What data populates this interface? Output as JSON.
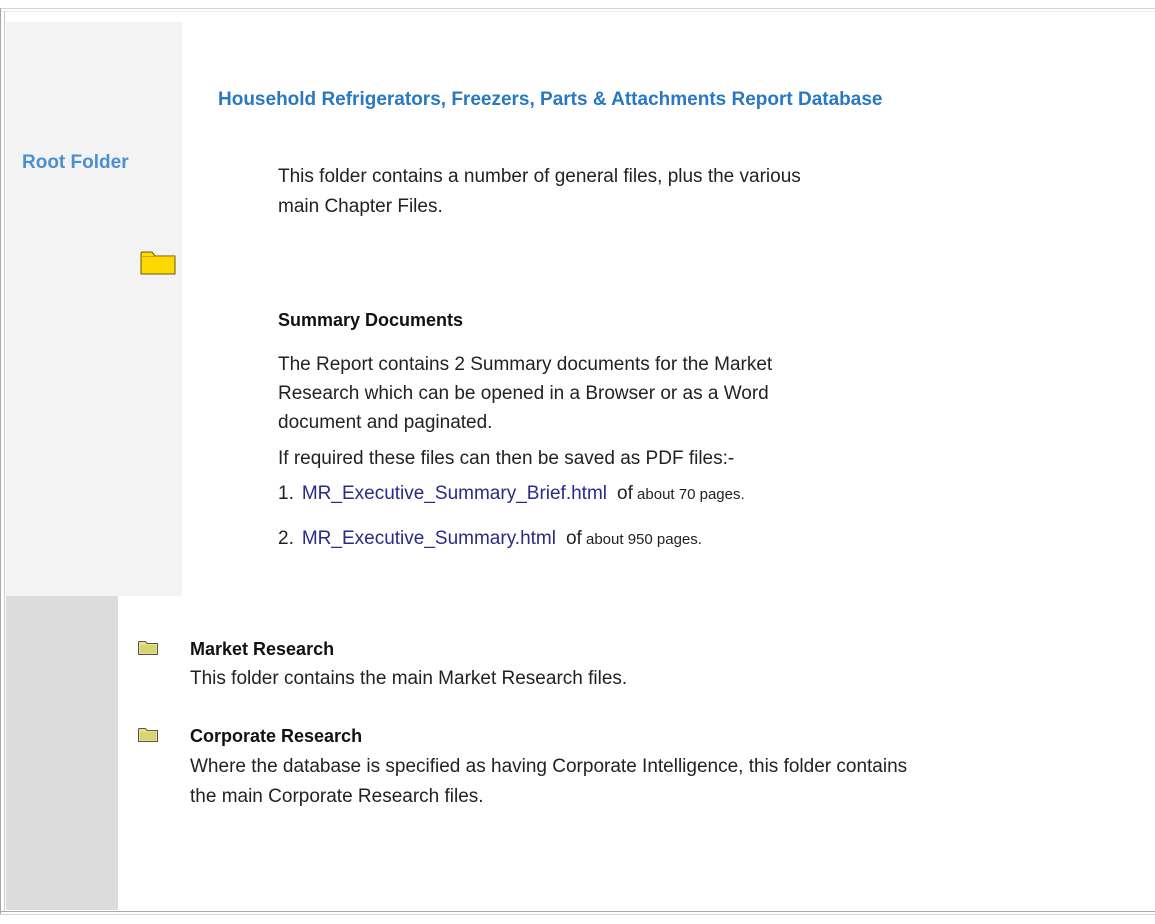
{
  "sidebar": {
    "root_folder_label": "Root Folder",
    "folder_icon": "folder-icon"
  },
  "main": {
    "title": "Household Refrigerators, Freezers, Parts & Attachments Report Database",
    "intro": "This folder contains a number of general files, plus the various main Chapter Files.",
    "summary": {
      "heading": "Summary Documents",
      "text": "The Report contains 2 Summary documents for the Market Research which can be opened in a Browser or as a Word document and paginated.",
      "pdf_note": "If required these files can then be saved as PDF files:-",
      "items": [
        {
          "number": "1.",
          "link": "MR_Executive_Summary_Brief.html",
          "of": "of",
          "rest": " about 70 pages."
        },
        {
          "number": "2.",
          "link": "MR_Executive_Summary.html",
          "of": "of",
          "rest": " about 950 pages."
        }
      ]
    }
  },
  "folders": [
    {
      "icon": "folder-icon",
      "heading": "Market Research",
      "text": "This folder contains the main Market Research files."
    },
    {
      "icon": "folder-icon",
      "heading": "Corporate Research",
      "text": "Where the database is specified as having Corporate Intelligence, this folder contains the main Corporate Research files."
    }
  ],
  "colors": {
    "title": "#2878c4",
    "root_label": "#4a8fd0",
    "link": "#2a2a8a",
    "folder_yellow": "#ffd800"
  }
}
